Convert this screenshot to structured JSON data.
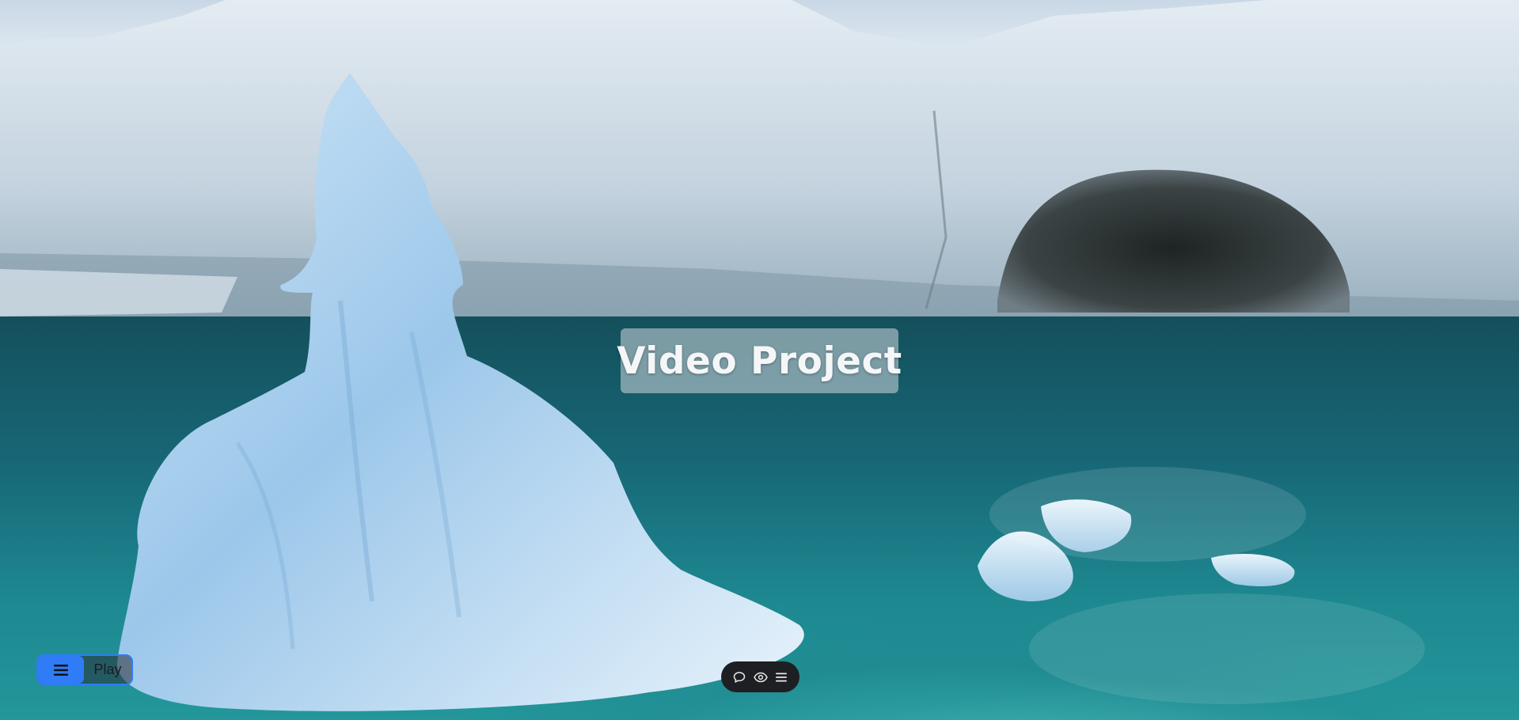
{
  "overlay": {
    "title": "Video Project"
  },
  "controls": {
    "play_label": "Play",
    "menu_icon": "hamburger-menu-icon"
  },
  "toolbar": {
    "icons": [
      "comment-icon",
      "eye-icon",
      "list-menu-icon"
    ]
  },
  "colors": {
    "accent": "#2f7cf6",
    "toolbar_bg": "#1e1f22",
    "title_bg": "rgba(210,215,220,0.55)"
  }
}
